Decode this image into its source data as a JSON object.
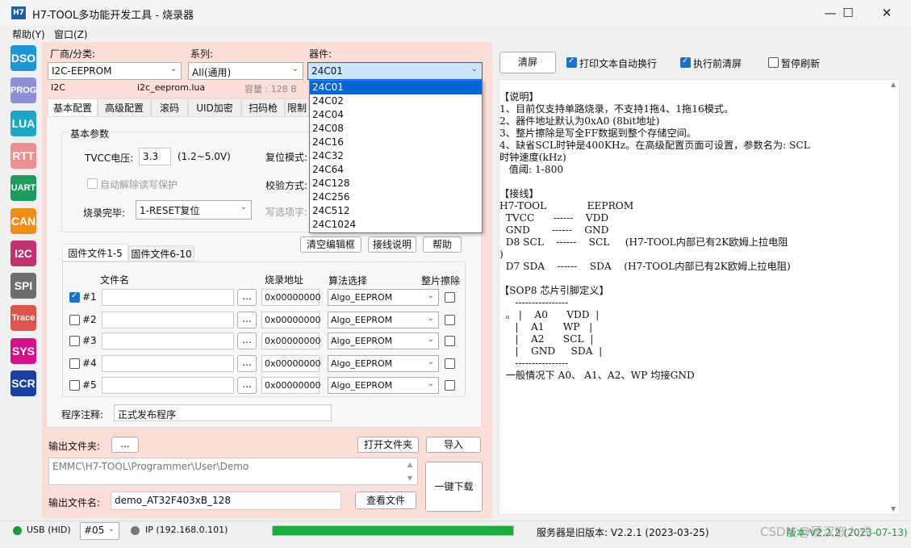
{
  "window": {
    "title": "H7-TOOL多功能开发工具 - 烧录器",
    "icon_text": "H7",
    "min": "—",
    "max": "☐",
    "close": "✕"
  },
  "menu": [
    {
      "label": "帮助(Y)"
    },
    {
      "label": "窗口(Z)"
    }
  ],
  "sidebar": [
    {
      "label": "DSO",
      "color": "#1e96d8"
    },
    {
      "label": "PROG",
      "color": "#8b8fd6"
    },
    {
      "label": "LUA",
      "color": "#1fa6c7"
    },
    {
      "label": "RTT",
      "color": "#f08f8f"
    },
    {
      "label": "UART",
      "color": "#1d9c5d"
    },
    {
      "label": "CAN",
      "color": "#f08c1a"
    },
    {
      "label": "I2C",
      "color": "#c2306e"
    },
    {
      "label": "SPI",
      "color": "#6e6e6e"
    },
    {
      "label": "Trace",
      "color": "#e0554b"
    },
    {
      "label": "SYS",
      "color": "#d3128a"
    },
    {
      "label": "SCR",
      "color": "#1b3fa0"
    }
  ],
  "selectors": {
    "vendor_label": "厂商/分类:",
    "vendor_value": "I2C-EEPROM",
    "series_label": "系列:",
    "series_value": "All(通用)",
    "device_label": "器件:",
    "device_value": "24C01",
    "interface": "I2C",
    "lua_file": "i2c_eeprom.lua",
    "capacity": "容量 : 128 B"
  },
  "device_options": [
    "24C01",
    "24C02",
    "24C04",
    "24C08",
    "24C16",
    "24C32",
    "24C64",
    "24C128",
    "24C256",
    "24C512",
    "24C1024"
  ],
  "tabs": [
    "基本配置",
    "高级配置",
    "滚码",
    "UID加密",
    "扫码枪",
    "限制"
  ],
  "basic": {
    "group_label": "基本参数",
    "vtcc_label": "TVCC电压:",
    "vtcc_value": "3.3",
    "vtcc_range": "(1.2~5.0V)",
    "reset_mode_label": "复位模式:",
    "auto_unlock_label": "自动解除读写保护",
    "verify_label": "校验方式:",
    "after_burn_label": "烧录完毕:",
    "after_burn_value": "1-RESET复位",
    "write_option_label": "写选项字:"
  },
  "action_buttons": [
    "清空编辑框",
    "接线说明",
    "帮助"
  ],
  "file_tabs": [
    "固件文件1-5",
    "固件文件6-10"
  ],
  "file_table": {
    "headers": [
      "文件名",
      "烧录地址",
      "算法选择",
      "整片擦除"
    ],
    "rows": [
      {
        "id": "#1",
        "checked": true,
        "addr": "0x00000000",
        "algo": "Algo_EEPROM"
      },
      {
        "id": "#2",
        "checked": false,
        "addr": "0x00000000",
        "algo": "Algo_EEPROM"
      },
      {
        "id": "#3",
        "checked": false,
        "addr": "0x00000000",
        "algo": "Algo_EEPROM"
      },
      {
        "id": "#4",
        "checked": false,
        "addr": "0x00000000",
        "algo": "Algo_EEPROM"
      },
      {
        "id": "#5",
        "checked": false,
        "addr": "0x00000000",
        "algo": "Algo_EEPROM"
      }
    ],
    "browse": "..."
  },
  "comment": {
    "label": "程序注释:",
    "value": "正式发布程序"
  },
  "output": {
    "folder_label": "输出文件夹:",
    "folder_btn": "...",
    "open_folder_btn": "打开文件夹",
    "import_btn": "导入",
    "path": "EMMC\\H7-TOOL\\Programmer\\User\\Demo",
    "filename_label": "输出文件名:",
    "filename_value": "demo_AT32F403xB_128",
    "view_btn": "查看文件",
    "one_key_btn": "一键下载"
  },
  "right_toolbar": {
    "clear_btn": "清屏",
    "wrap_label": "打印文本自动换行",
    "wrap_checked": true,
    "clear_before_label": "执行前清屏",
    "clear_before_checked": true,
    "pause_label": "暂停刷新",
    "pause_checked": false
  },
  "log_lines": [
    "【说明】",
    "1、目前仅支持单路烧录，不支持1拖4、1拖16模式。",
    "2、器件地址默认为0xA0 (8bit地址)",
    "3、整片擦除是写全FF数据到整个存储空间。",
    "4、缺省SCL时钟是400KHz。在高级配置页面可设置，参数名为: SCL",
    "时钟速度(kHz)",
    "   值阈: 1-800",
    "",
    "【接线】",
    "H7-TOOL             EEPROM",
    "  TVCC      ------    VDD",
    "  GND       ------    GND",
    "  D8 SCL    ------    SCL     (H7-TOOL内部已有2K欧姆上拉电阻",
    ")",
    "  D7 SDA    ------    SDA    (H7-TOOL内部已有2K欧姆上拉电阻)",
    "",
    "【SOP8 芯片引脚定义】",
    "     ----------------",
    "  。 |    A0      VDD  |",
    "     |    A1      WP   |",
    "     |    A2      SCL  |",
    "     |    GND     SDA  |",
    "     ----------------",
    "  一般情况下 A0、 A1、A2、WP 均接GND"
  ],
  "status": {
    "usb": "USB (HID)",
    "port": "#05",
    "ip": "IP (192.168.0.101)",
    "progress": 1.0,
    "server": "服务器是旧版本: V2.2.1 (2023-03-25)",
    "version": "版本:V2.2.2 (2023-07-13)",
    "watermark": "CSDN @硬汉嵌入式"
  },
  "colors": {
    "accent": "#0a64d6",
    "progress": "#1aad3e",
    "panel_left": "#fbded6"
  }
}
